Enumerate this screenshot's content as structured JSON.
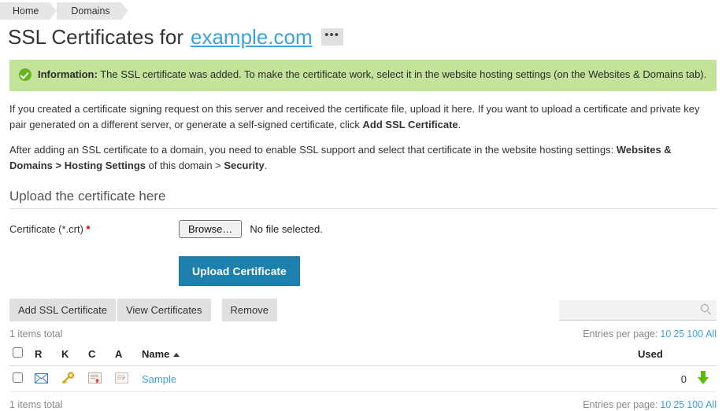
{
  "breadcrumb": {
    "items": [
      {
        "label": "Home"
      },
      {
        "label": "Domains"
      }
    ]
  },
  "header": {
    "title_prefix": "SSL Certificates for",
    "domain": "example.com",
    "more_button_label": "•••"
  },
  "info_banner": {
    "icon": "check-circle-icon",
    "label": "Information:",
    "message": "The SSL certificate was added. To make the certificate work, select it in the website hosting settings (on the Websites & Domains tab)."
  },
  "paragraphs": [
    {
      "part1": "If you created a certificate signing request on this server and received the certificate file, upload it here. If you want to upload a certificate and private key pair generated on a different server, or generate a self-signed certificate, click ",
      "strong1": "Add SSL Certificate",
      "part2": "."
    },
    {
      "part1": "After adding an SSL certificate to a domain, you need to enable SSL support and select that certificate in the website hosting settings: ",
      "strong1": "Websites & Domains > Hosting Settings",
      "part2": " of this domain > ",
      "strong2": "Security",
      "part3": "."
    }
  ],
  "upload_section": {
    "heading": "Upload the certificate here",
    "certificate_field": {
      "label": "Certificate (*.crt)",
      "required_marker": "*",
      "browse_label": "Browse…",
      "file_status": "No file selected."
    },
    "submit_label": "Upload Certificate"
  },
  "toolbar": {
    "add_label": "Add SSL Certificate",
    "view_label": "View Certificates",
    "remove_label": "Remove",
    "search": {
      "value": "",
      "placeholder": "",
      "icon": "search-icon"
    }
  },
  "list": {
    "items_total_top": "1 items total",
    "items_total_bottom": "1 items total",
    "entries_label": "Entries per page:",
    "entries_options": [
      "10",
      "25",
      "100",
      "All"
    ],
    "columns": [
      {
        "key": "check",
        "label": ""
      },
      {
        "key": "r",
        "label": "R"
      },
      {
        "key": "k",
        "label": "K"
      },
      {
        "key": "c",
        "label": "C"
      },
      {
        "key": "a",
        "label": "A"
      },
      {
        "key": "name",
        "label": "Name",
        "sort": "asc"
      },
      {
        "key": "used",
        "label": "Used"
      },
      {
        "key": "download",
        "label": ""
      }
    ],
    "rows": [
      {
        "name": "Sample",
        "used": "0",
        "r_icon": "envelope-icon",
        "k_icon": "key-icon",
        "c_icon": "certificate-icon",
        "a_icon": "ca-certificate-icon",
        "download_icon": "green-down-arrow-icon"
      }
    ]
  },
  "colors": {
    "accent_blue": "#1d7fab",
    "link_blue": "#3ba2dd",
    "banner_green": "#c3e29a",
    "check_green": "#60b81b",
    "arrow_green": "#56c000",
    "required_red": "#c00000",
    "button_grey": "#e0e0e0"
  }
}
